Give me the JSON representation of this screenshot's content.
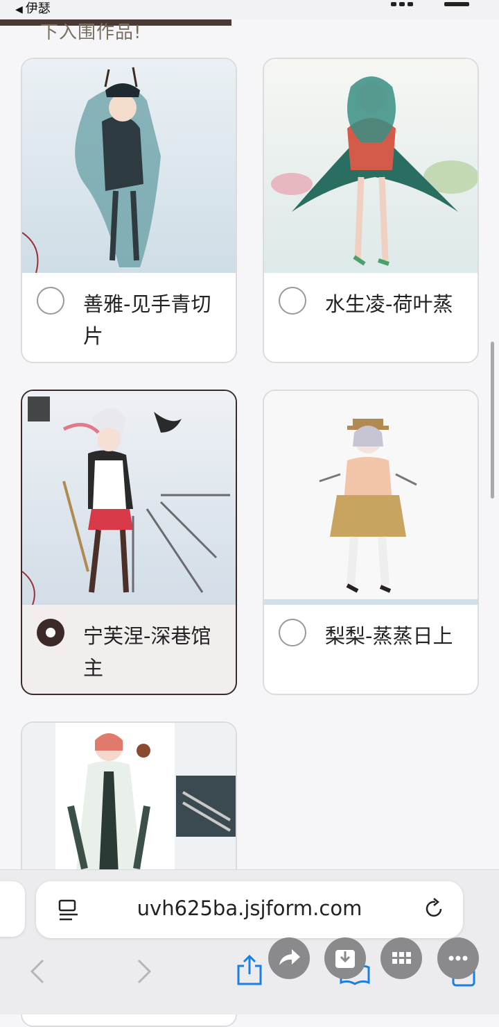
{
  "status": {
    "back_label": "伊瑟"
  },
  "intro": {
    "text": "下入围作品!"
  },
  "options": [
    {
      "label": "善雅-见手青切片",
      "selected": false
    },
    {
      "label": "水生凌-荷叶蒸",
      "selected": false
    },
    {
      "label": "宁芙涅-深巷馆主",
      "selected": true
    },
    {
      "label": "梨梨-蒸蒸日上",
      "selected": false
    },
    {
      "label": "",
      "selected": false
    }
  ],
  "browser": {
    "url": "uvh625ba.jsjform.com"
  },
  "colors": {
    "accent": "#3b2a27",
    "page_bg": "#f6f6f8",
    "card_border": "#dcdcdf",
    "toolbar_bg": "#ececef"
  },
  "icons": [
    "back-arrow-icon",
    "reader-icon",
    "reload-icon",
    "chevron-left-icon",
    "chevron-right-icon",
    "share-icon",
    "bookmarks-icon",
    "tabs-icon",
    "forward-share-icon",
    "download-icon",
    "grid-icon",
    "more-icon"
  ]
}
